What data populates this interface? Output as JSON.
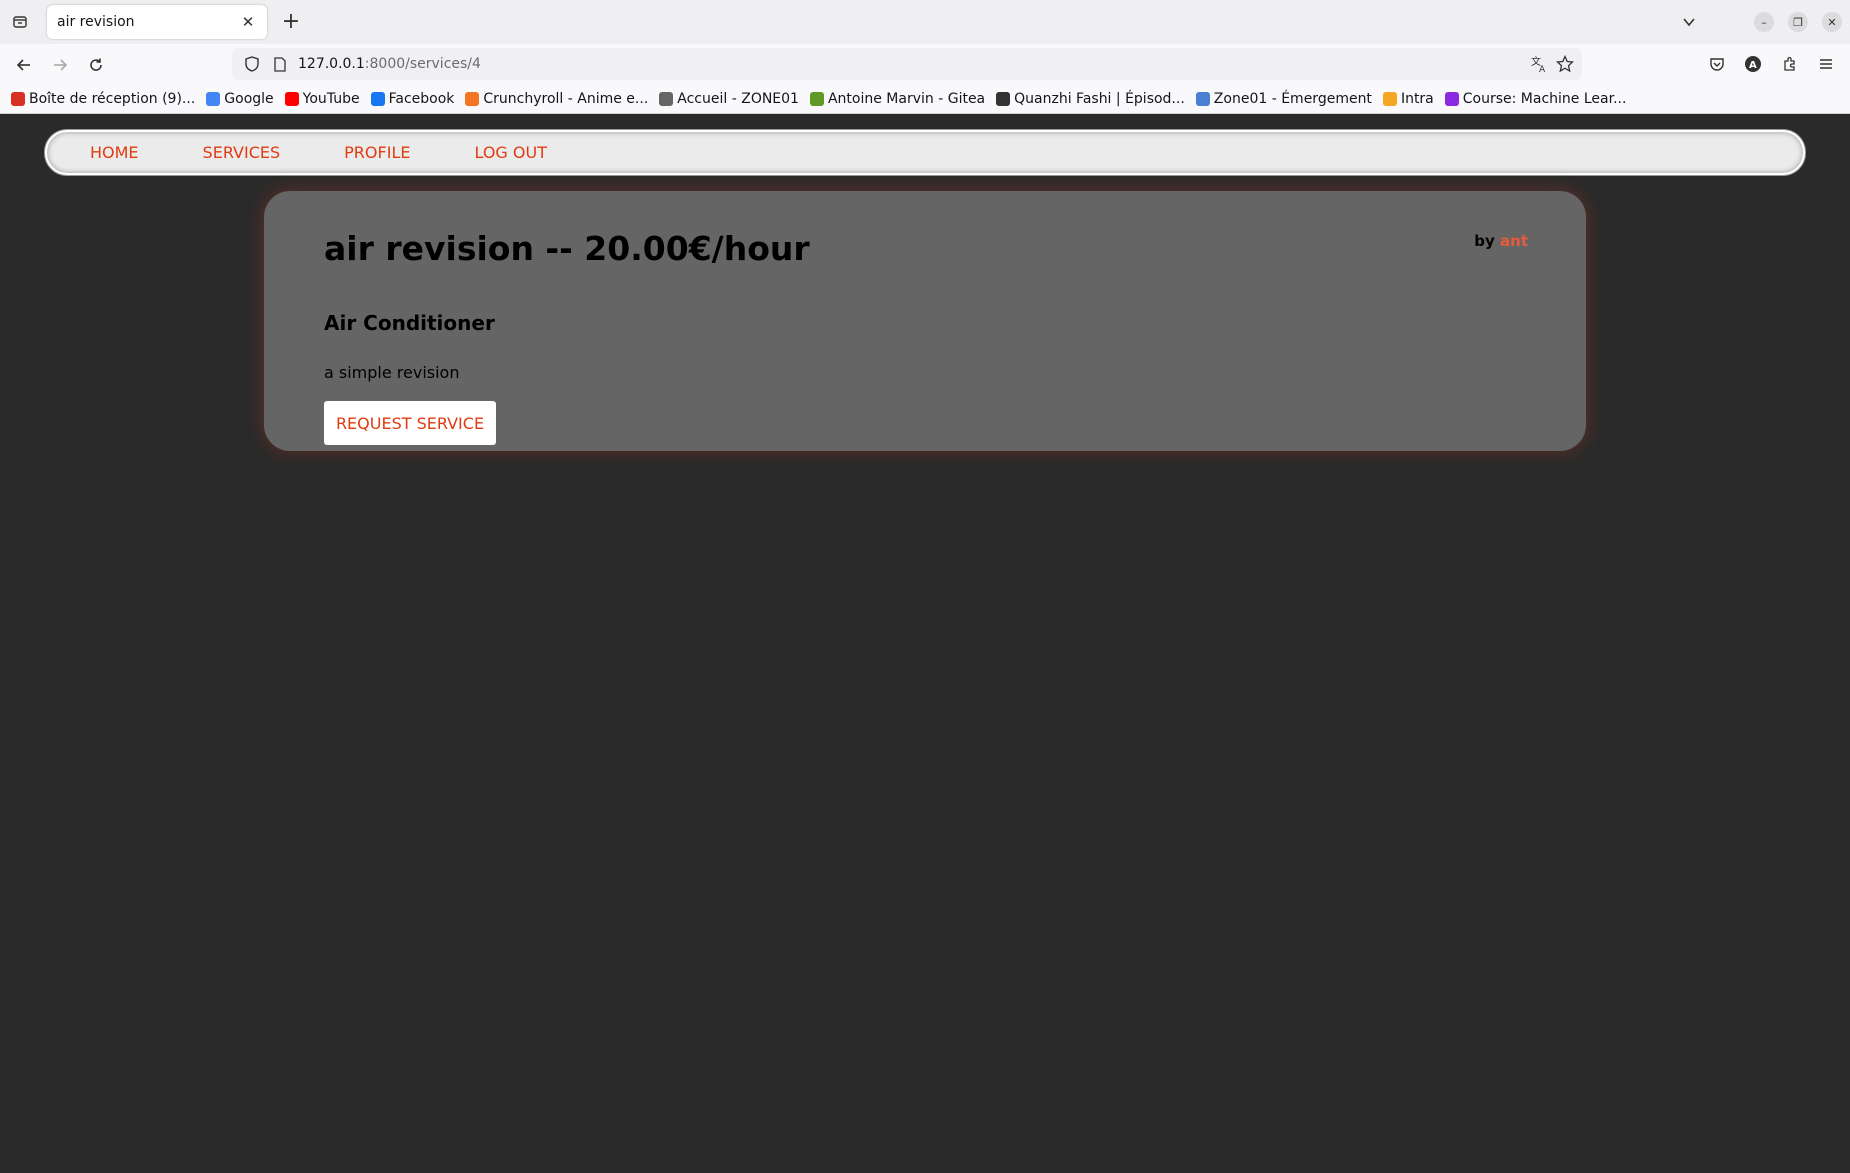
{
  "browser": {
    "tab_title": "air revision",
    "url_host": "127.0.0.1",
    "url_rest": ":8000/services/4",
    "bookmarks": [
      {
        "label": "Boîte de réception (9)...",
        "icon": "gmail-icon",
        "color": "#d93025"
      },
      {
        "label": "Google",
        "icon": "google-icon",
        "color": "#4285f4"
      },
      {
        "label": "YouTube",
        "icon": "youtube-icon",
        "color": "#ff0000"
      },
      {
        "label": "Facebook",
        "icon": "facebook-icon",
        "color": "#1877f2"
      },
      {
        "label": "Crunchyroll - Anime e...",
        "icon": "crunchyroll-icon",
        "color": "#f47521"
      },
      {
        "label": "Accueil - ZONE01",
        "icon": "zone01-icon",
        "color": "#666666"
      },
      {
        "label": "Antoine Marvin - Gitea",
        "icon": "gitea-icon",
        "color": "#609926"
      },
      {
        "label": "Quanzhi Fashi | Épisod...",
        "icon": "globe-icon",
        "color": "#333333"
      },
      {
        "label": "Zone01 - Émergement",
        "icon": "zone01-doc-icon",
        "color": "#4a7fd4"
      },
      {
        "label": "Intra",
        "icon": "code-icon",
        "color": "#f5a623"
      },
      {
        "label": "Course: Machine Lear...",
        "icon": "course-icon",
        "color": "#8a2be2"
      }
    ]
  },
  "site_nav": {
    "items": [
      "HOME",
      "SERVICES",
      "PROFILE",
      "LOG OUT"
    ]
  },
  "service": {
    "title": "air revision -- 20.00€/hour",
    "by_label": "by",
    "author": "ant",
    "category": "Air Conditioner",
    "description": "a simple revision",
    "request_button": "REQUEST SERVICE"
  },
  "colors": {
    "accent": "#e23b10",
    "page_bg": "#2a2a2a",
    "card_bg": "#656565"
  }
}
